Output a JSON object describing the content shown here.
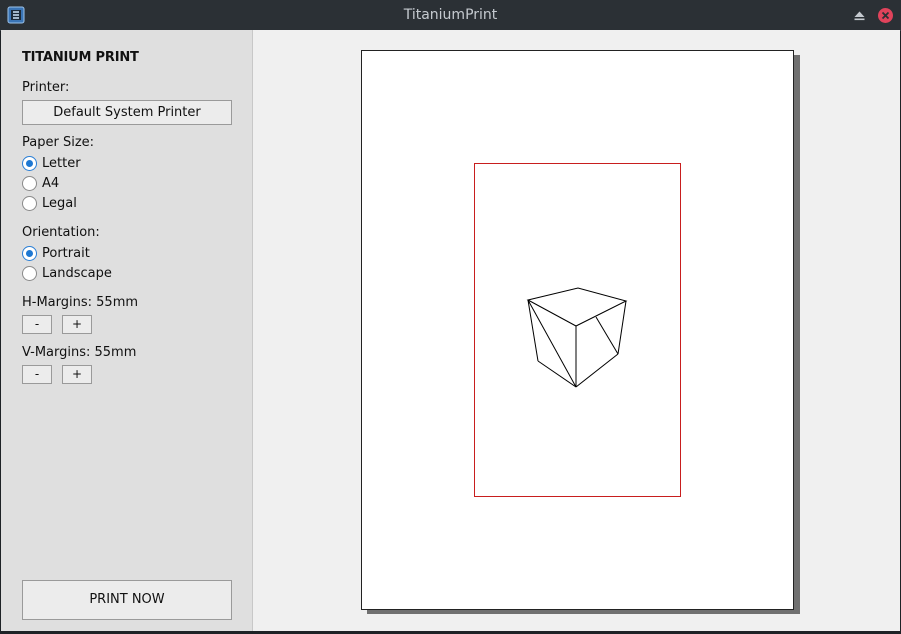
{
  "window": {
    "title": "TitaniumPrint",
    "app_icon": "app-logo-icon",
    "controls": {
      "minimize": "eject-icon",
      "close": "close-icon"
    }
  },
  "sidebar": {
    "brand": "TITANIUM PRINT",
    "printer_label": "Printer:",
    "printer_button": "Default System Printer",
    "paper_size_label": "Paper Size:",
    "paper_sizes": [
      {
        "label": "Letter",
        "checked": true
      },
      {
        "label": "A4",
        "checked": false
      },
      {
        "label": "Legal",
        "checked": false
      }
    ],
    "orientation_label": "Orientation:",
    "orientations": [
      {
        "label": "Portrait",
        "checked": true
      },
      {
        "label": "Landscape",
        "checked": false
      }
    ],
    "h_margins_label": "H-Margins: 55mm",
    "v_margins_label": "V-Margins: 55mm",
    "minus": "-",
    "plus": "+",
    "print_button": "PRINT NOW"
  },
  "colors": {
    "accent": "#1e78d2",
    "margin_border": "#c81e1e",
    "sidebar_bg": "#dfdfdf",
    "titlebar_bg": "#2b3035"
  }
}
